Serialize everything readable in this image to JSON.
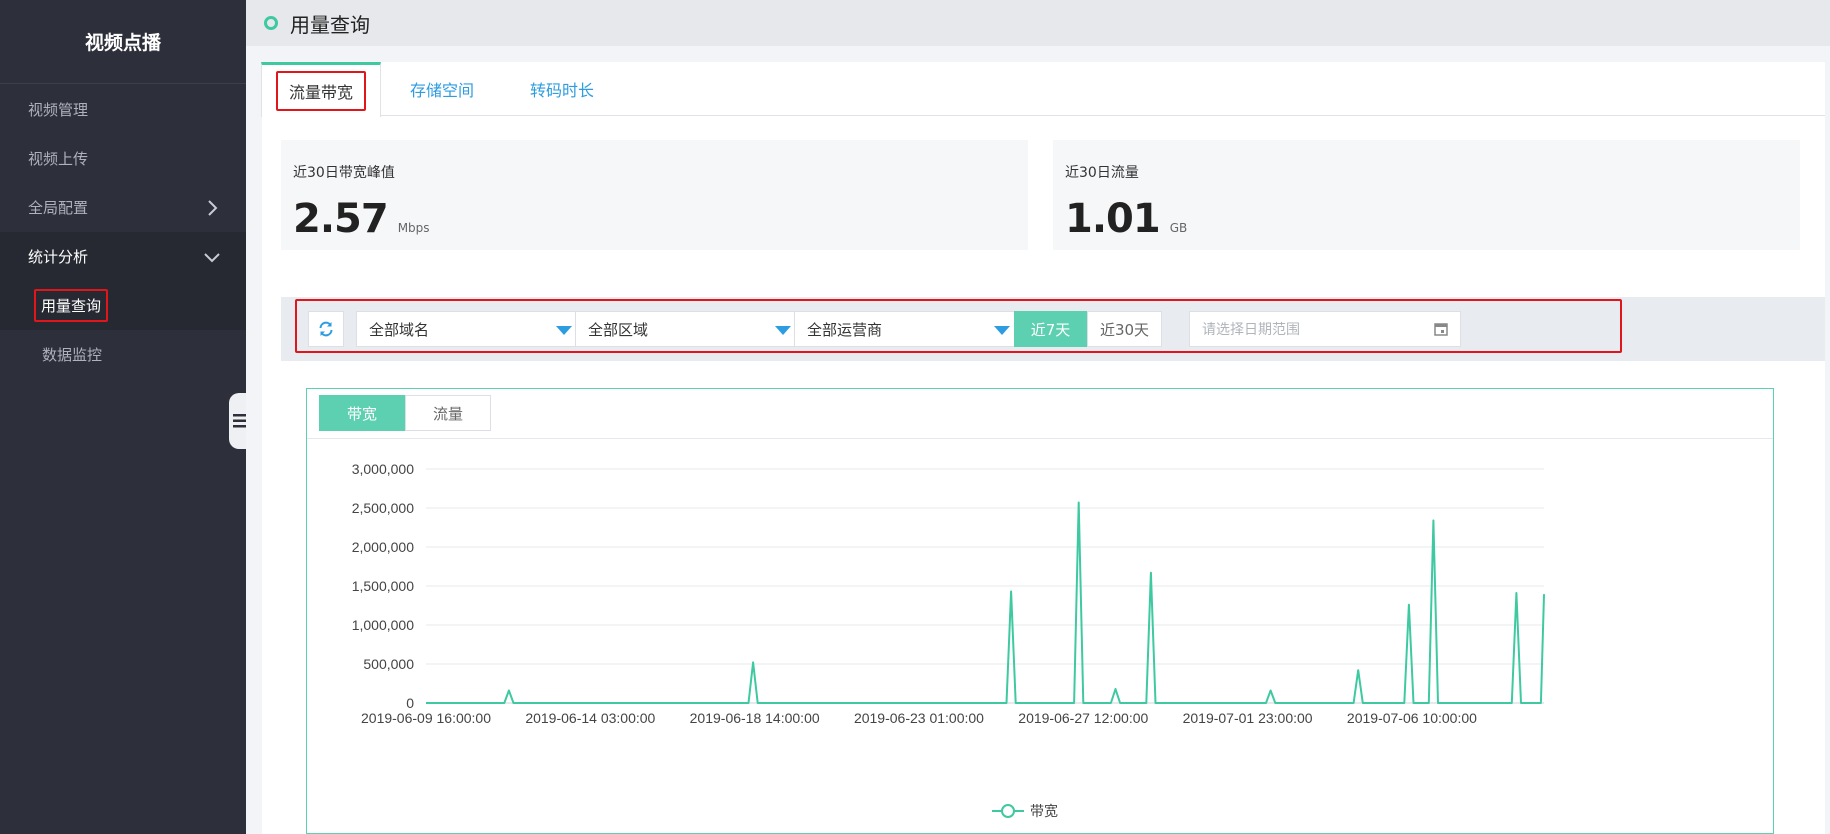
{
  "sidebar": {
    "brand": "视频点播",
    "items": [
      {
        "label": "视频管理"
      },
      {
        "label": "视频上传"
      },
      {
        "label": "全局配置"
      },
      {
        "label": "统计分析"
      }
    ],
    "sub_items": [
      {
        "label": "用量查询"
      },
      {
        "label": "数据监控"
      }
    ]
  },
  "header": {
    "title": "用量查询"
  },
  "tabs": [
    {
      "label": "流量带宽"
    },
    {
      "label": "存储空间"
    },
    {
      "label": "转码时长"
    }
  ],
  "stats": {
    "peak": {
      "label": "近30日带宽峰值",
      "value": "2.57",
      "unit": "Mbps"
    },
    "traffic": {
      "label": "近30日流量",
      "value": "1.01",
      "unit": "GB"
    }
  },
  "filters": {
    "domain": "全部域名",
    "region": "全部区域",
    "isp": "全部运营商",
    "range_7": "近7天",
    "range_30": "近30天",
    "date_placeholder": "请选择日期范围"
  },
  "chart_tabs": {
    "bandwidth": "带宽",
    "traffic": "流量"
  },
  "colors": {
    "accent": "#3ec9a1",
    "link": "#2d9ce0",
    "sidebar": "#2d2f3a",
    "highlight": "#e0161b"
  },
  "chart_data": {
    "type": "line",
    "title": "",
    "xlabel": "",
    "ylabel": "",
    "ylim": [
      0,
      3000000
    ],
    "yticks": [
      0,
      500000,
      1000000,
      1500000,
      2000000,
      2500000,
      3000000
    ],
    "ytick_labels": [
      "0",
      "500,000",
      "1,000,000",
      "1,500,000",
      "2,000,000",
      "2,500,000",
      "3,000,000"
    ],
    "xtick_labels": [
      "2019-06-09 16:00:00",
      "2019-06-14 03:00:00",
      "2019-06-18 14:00:00",
      "2019-06-23 01:00:00",
      "2019-06-27 12:00:00",
      "2019-07-01 23:00:00",
      "2019-07-06 10:00:00"
    ],
    "x_start": "2019-06-09 16:00:00",
    "x_end": "2019-07-10 00:00:00",
    "legend": "bottom",
    "grid": true,
    "series": [
      {
        "name": "带宽",
        "points": [
          [
            "2019-06-09 16:00:00",
            0
          ],
          [
            "2019-06-10 12:00:00",
            0
          ],
          [
            "2019-06-11 19:00:00",
            0
          ],
          [
            "2019-06-11 22:00:00",
            160000
          ],
          [
            "2019-06-12 01:00:00",
            0
          ],
          [
            "2019-06-18 10:00:00",
            0
          ],
          [
            "2019-06-18 13:00:00",
            520000
          ],
          [
            "2019-06-18 16:00:00",
            0
          ],
          [
            "2019-06-25 10:00:00",
            0
          ],
          [
            "2019-06-25 13:00:00",
            1430000
          ],
          [
            "2019-06-25 16:00:00",
            0
          ],
          [
            "2019-06-27 06:00:00",
            0
          ],
          [
            "2019-06-27 09:00:00",
            2570000
          ],
          [
            "2019-06-27 12:00:00",
            0
          ],
          [
            "2019-06-28 06:00:00",
            0
          ],
          [
            "2019-06-28 09:00:00",
            180000
          ],
          [
            "2019-06-28 12:00:00",
            0
          ],
          [
            "2019-06-29 05:00:00",
            0
          ],
          [
            "2019-06-29 08:00:00",
            1670000
          ],
          [
            "2019-06-29 11:00:00",
            0
          ],
          [
            "2019-07-02 11:00:00",
            0
          ],
          [
            "2019-07-02 14:00:00",
            160000
          ],
          [
            "2019-07-02 17:00:00",
            0
          ],
          [
            "2019-07-04 20:00:00",
            0
          ],
          [
            "2019-07-04 23:00:00",
            420000
          ],
          [
            "2019-07-05 02:00:00",
            0
          ],
          [
            "2019-07-06 05:00:00",
            0
          ],
          [
            "2019-07-06 08:00:00",
            1260000
          ],
          [
            "2019-07-06 11:00:00",
            0
          ],
          [
            "2019-07-06 21:00:00",
            0
          ],
          [
            "2019-07-07 00:00:00",
            2340000
          ],
          [
            "2019-07-07 03:00:00",
            0
          ],
          [
            "2019-07-09 03:00:00",
            0
          ],
          [
            "2019-07-09 06:00:00",
            1410000
          ],
          [
            "2019-07-09 09:00:00",
            0
          ],
          [
            "2019-07-09 22:00:00",
            0
          ],
          [
            "2019-07-10 00:00:00",
            1390000
          ]
        ]
      }
    ]
  }
}
